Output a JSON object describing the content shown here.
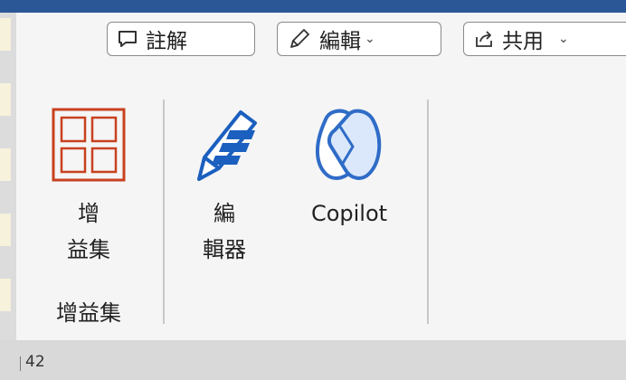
{
  "toolbar": {
    "comments_label": "註解",
    "editing_label": "編輯",
    "share_label": "共用"
  },
  "ribbon": {
    "addins_button_line1": "增",
    "addins_button_line2": "益集",
    "addins_group_label": "增益集",
    "editor_button_line1": "編",
    "editor_button_line2": "輯器",
    "copilot_label": "Copilot"
  },
  "status": {
    "page_number": "42"
  },
  "colors": {
    "addins_icon": "#c8411f",
    "editor_icon": "#1b5fbf",
    "copilot_icon": "#2f6cc7",
    "title_bar": "#2b5797"
  },
  "icons": {
    "comments": "comment-icon",
    "editing": "pencil-icon",
    "share": "share-icon",
    "addins": "grid-icon",
    "editor": "editor-pen-icon",
    "copilot": "copilot-icon",
    "dropdown": "chevron-down-icon"
  }
}
